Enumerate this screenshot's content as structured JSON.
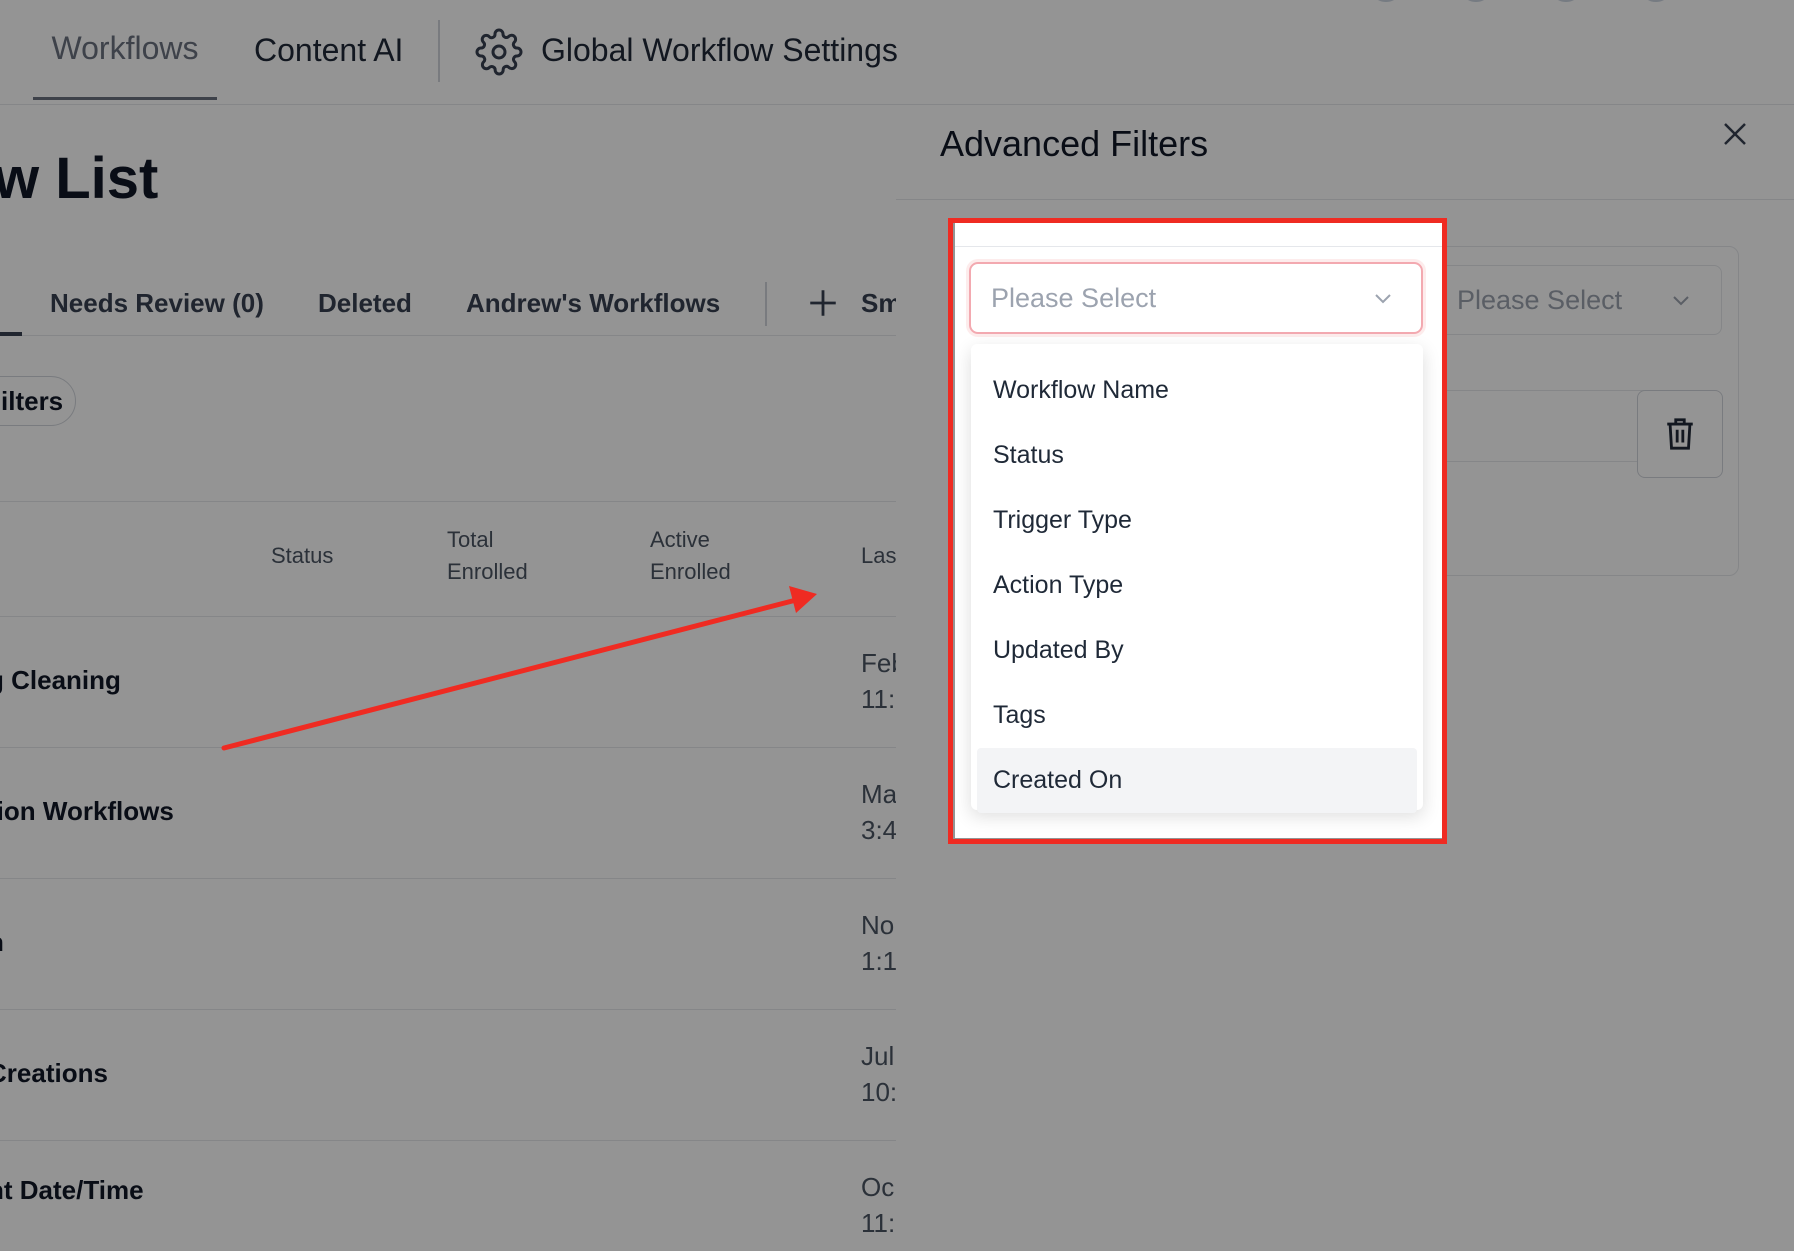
{
  "colors": {
    "annotation_red": "#ef2b22",
    "select_focus_border": "#f3a9b0",
    "hover_bg": "#f3f4f6"
  },
  "topnav": {
    "tabs": [
      {
        "label": "Workflows",
        "active": true
      },
      {
        "label": "Content AI",
        "active": false
      }
    ],
    "settings_label": "Global Workflow Settings",
    "settings_icon": "gear-icon"
  },
  "page": {
    "title_fragment": "w List",
    "subtabs": [
      "Needs Review (0)",
      "Deleted",
      "Andrew's Workflows",
      "Sm"
    ],
    "add_icon": "plus-icon",
    "filters_label": "ilters",
    "table": {
      "headers": {
        "status": "Status",
        "total_enrolled": "Total\nEnrolled",
        "active_enrolled": "Active\nEnrolled",
        "last": "Las"
      },
      "rows": [
        {
          "name": "g Cleaning",
          "date_line1": "Feb",
          "date_line2": "11:"
        },
        {
          "name": "tion Workflows",
          "date_line1": "Ma",
          "date_line2": "3:4"
        },
        {
          "name": "n",
          "date_line1": "No",
          "date_line2": "1:1"
        },
        {
          "name": "Creations",
          "date_line1": "Jul",
          "date_line2": "10:"
        },
        {
          "name": "nt Date/Time",
          "date_line1": "Oc",
          "date_line2": "11:"
        }
      ]
    }
  },
  "drawer": {
    "title": "Advanced Filters",
    "close_icon": "close-icon",
    "field_select": {
      "placeholder": "Please Select",
      "options": [
        "Workflow Name",
        "Status",
        "Trigger Type",
        "Action Type",
        "Updated By",
        "Tags",
        "Created On"
      ],
      "hovered_option": "Created On"
    },
    "operator_select": {
      "placeholder": "Please Select"
    },
    "delete_icon": "trash-icon"
  }
}
